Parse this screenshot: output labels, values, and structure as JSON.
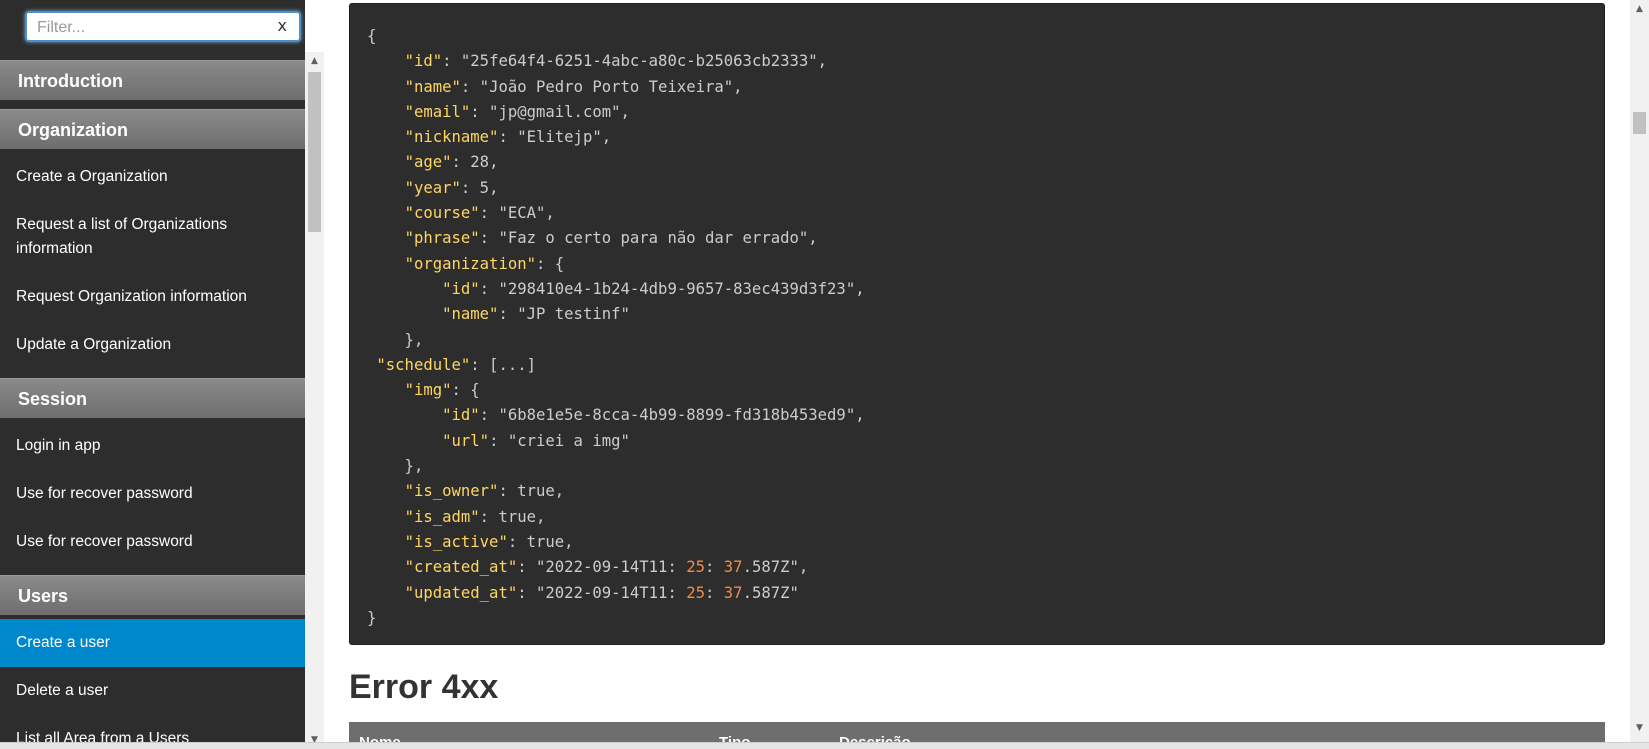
{
  "filter": {
    "placeholder": "Filter...",
    "clear_label": "x"
  },
  "nav": {
    "sections": [
      {
        "title": "Introduction",
        "items": []
      },
      {
        "title": "Organization",
        "items": [
          "Create a Organization",
          "Request a list of Organizations information",
          "Request Organization information",
          "Update a Organization"
        ]
      },
      {
        "title": "Session",
        "items": [
          "Login in app",
          "Use for recover password",
          "Use for recover password"
        ]
      },
      {
        "title": "Users",
        "items": [
          "Create a user",
          "Delete a user",
          "List all Area from a Users"
        ]
      }
    ],
    "active_item": "Create a user"
  },
  "scroll_glyphs": {
    "up": "▲",
    "down": "▼"
  },
  "code_lines": [
    "{",
    "    \"id\": \"25fe64f4-6251-4abc-a80c-b25063cb2333\",",
    "    \"name\": \"João Pedro Porto Teixeira\",",
    "    \"email\": \"jp@gmail.com\",",
    "    \"nickname\": \"Elitejp\",",
    "    \"age\": 28,",
    "    \"year\": 5,",
    "    \"course\": \"ECA\",",
    "    \"phrase\": \"Faz o certo para não dar errado\",",
    "    \"organization\": {",
    "        \"id\": \"298410e4-1b24-4db9-9657-83ec439d3f23\",",
    "        \"name\": \"JP testinf\"",
    "    },",
    " \"schedule\": [...]",
    "    \"img\": {",
    "        \"id\": \"6b8e1e5e-8cca-4b99-8899-fd318b453ed9\",",
    "        \"url\": \"criei a img\"",
    "    },",
    "    \"is_owner\": true,",
    "    \"is_adm\": true,",
    "    \"is_active\": true,",
    "    \"created_at\": \"2022-09-14T11:25:37.587Z\",",
    "    \"updated_at\": \"2022-09-14T11:25:37.587Z\"",
    "}"
  ],
  "error_section": {
    "title": "Error 4xx",
    "columns": [
      "Nome",
      "Tipo",
      "Descrição"
    ]
  },
  "colors": {
    "code_bg": "#2d2d2d",
    "key": "#ffd563",
    "string": "#91c46e",
    "number": "#f08d49",
    "active_nav": "#0088cc"
  }
}
